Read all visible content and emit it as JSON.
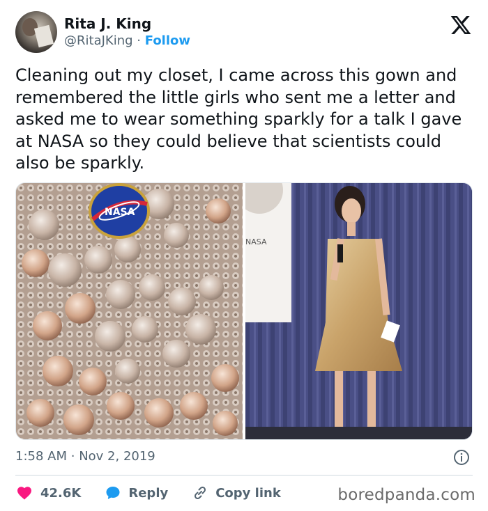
{
  "author": {
    "name": "Rita J. King",
    "handle": "@RitaJKing",
    "separator": "·",
    "follow_label": "Follow"
  },
  "tweet": {
    "text": "Cleaning out my closet, I came across this gown and remembered the little girls who sent me a letter and asked me to wear something sparkly for a talk I gave at NASA so they could believe that scientists could also be sparkly."
  },
  "media": {
    "sign_text": "NASA"
  },
  "meta": {
    "time": "1:58 AM",
    "separator": "·",
    "date": "Nov 2, 2019"
  },
  "actions": {
    "likes_count": "42.6K",
    "reply_label": "Reply",
    "copy_link_label": "Copy link"
  },
  "watermark": "boredpanda.com",
  "colors": {
    "accent": "#1d9bf0",
    "like": "#f91880",
    "muted": "#536471"
  },
  "icons": [
    "x-logo-icon",
    "heart-icon",
    "reply-bubble-icon",
    "link-icon",
    "info-icon"
  ]
}
